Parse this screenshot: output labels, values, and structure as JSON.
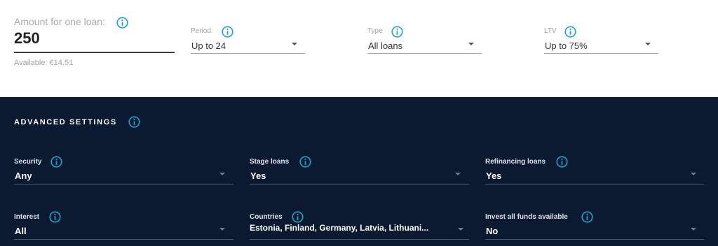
{
  "amount": {
    "label": "Amount for one loan:",
    "value": "250",
    "available": "Available: €14.51"
  },
  "filters": {
    "period": {
      "label": "Period",
      "value": "Up to 24"
    },
    "type": {
      "label": "Type",
      "value": "All loans"
    },
    "ltv": {
      "label": "LTV",
      "value": "Up to 75%"
    }
  },
  "advanced": {
    "title": "ADVANCED SETTINGS",
    "security": {
      "label": "Security",
      "value": "Any"
    },
    "stage_loans": {
      "label": "Stage loans",
      "value": "Yes"
    },
    "refinancing_loans": {
      "label": "Refinancing loans",
      "value": "Yes"
    },
    "interest": {
      "label": "Interest",
      "value": "All"
    },
    "countries": {
      "label": "Countries",
      "value": "Estonia, Finland, Germany, Latvia, Lithuani..."
    },
    "invest_all": {
      "label": "Invest all funds available",
      "value": "No"
    }
  },
  "colors": {
    "accent": "#1ba3cf",
    "dark_background": "#0b1a30"
  },
  "icons": {
    "info": "info-circle-icon",
    "dropdown": "caret-down-icon"
  }
}
